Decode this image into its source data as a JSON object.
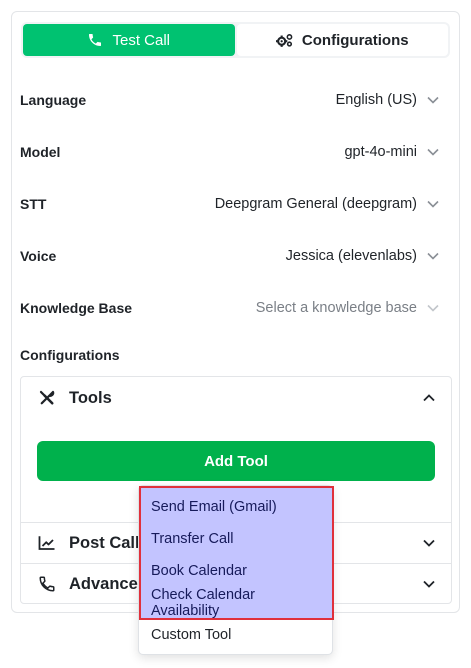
{
  "tabs": [
    {
      "label": "Test Call",
      "icon": "phone-icon",
      "active": true
    },
    {
      "label": "Configurations",
      "icon": "gears-icon",
      "active": false
    }
  ],
  "fields": {
    "language": {
      "label": "Language",
      "value": "English (US)"
    },
    "model": {
      "label": "Model",
      "value": "gpt-4o-mini"
    },
    "stt": {
      "label": "STT",
      "value": "Deepgram General (deepgram)"
    },
    "voice": {
      "label": "Voice",
      "value": "Jessica (elevenlabs)"
    },
    "knowledge_base": {
      "label": "Knowledge Base",
      "placeholder": "Select a knowledge base"
    }
  },
  "configurations": {
    "label": "Configurations",
    "sections": [
      {
        "title": "Tools",
        "icon": "tools-icon",
        "expanded": true
      },
      {
        "title": "Post Call",
        "icon": "chart-line-icon",
        "expanded": false
      },
      {
        "title": "Advance S",
        "icon": "phone-icon",
        "expanded": false
      }
    ],
    "add_tool_label": "Add Tool"
  },
  "tool_dropdown": {
    "options": [
      "Send Email (Gmail)",
      "Transfer Call",
      "Book Calendar",
      "Check Calendar Availability",
      "Custom Tool"
    ],
    "highlight_color": "#c3c4ff",
    "highlight_border": "#e0303b"
  },
  "colors": {
    "accent": "#00c271",
    "button": "#00b14c"
  }
}
